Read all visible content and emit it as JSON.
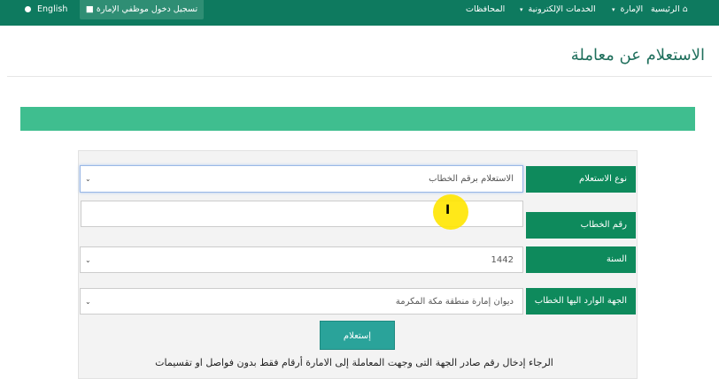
{
  "topbar": {
    "language_label": "English",
    "login_label": "تسجيل دخول موظفي الإمارة",
    "nav": {
      "home": "الرئيسية",
      "emirate": "الإمارة",
      "eservices": "الخدمات الإلكترونية",
      "governorates": "المحافظات"
    }
  },
  "page": {
    "title": "الاستعلام عن معاملة"
  },
  "form": {
    "inquiry_type_label": "نوع الاستعلام",
    "inquiry_type_value": "الاستعلام برقم الخطاب",
    "letter_number_label": "رقم الخطاب",
    "letter_number_value": "",
    "year_label": "السنة",
    "year_value": "1442",
    "destination_label": "الجهة الوارد اليها الخطاب",
    "destination_value": "ديوان إمارة منطقة مكة المكرمة",
    "submit_label": "إستعلام",
    "instruction": "الرجاء إدخال رقم صادر الجهة التى وجهت المعاملة إلى الامارة أرقام فقط بدون فواصل او تقسيمات"
  },
  "colors": {
    "topbar": "#0e7a5f",
    "label_green": "#0e8a5c",
    "banner_green": "#3fbe8f",
    "button_teal": "#2aa39a"
  },
  "icons": [
    "home-icon",
    "user-icon",
    "globe-icon",
    "caret-down-icon",
    "chevron-down-icon",
    "text-cursor-icon"
  ]
}
